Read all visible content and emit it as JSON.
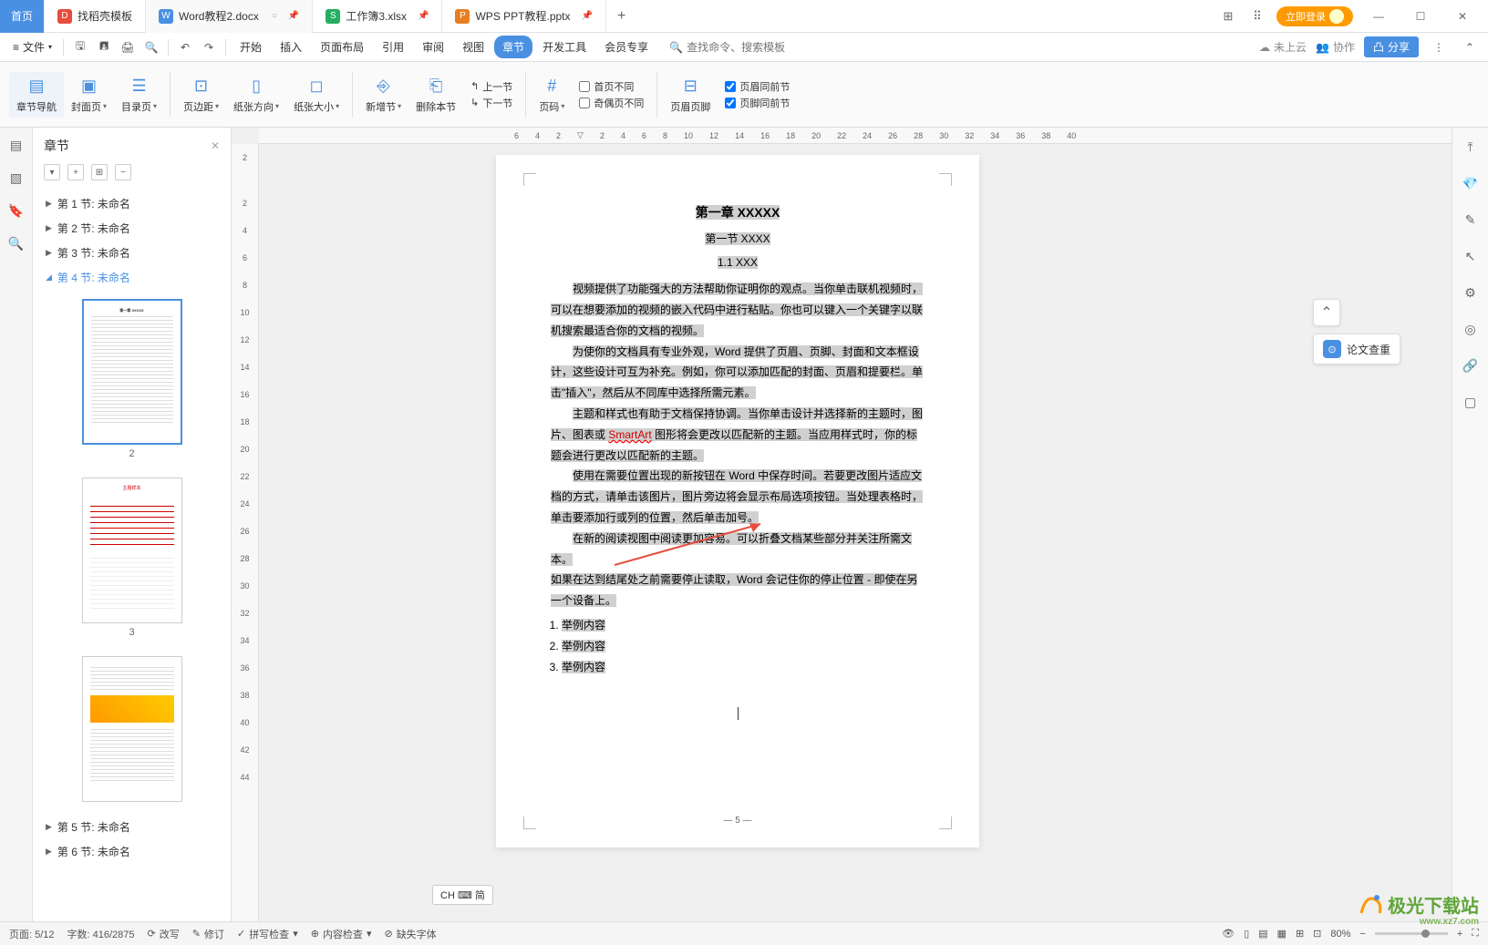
{
  "tabs": {
    "home": "首页",
    "t1": "找稻壳模板",
    "t2": "Word教程2.docx",
    "t3": "工作簿3.xlsx",
    "t4": "WPS PPT教程.pptx"
  },
  "titleRight": {
    "login": "立即登录"
  },
  "menu": {
    "file": "文件",
    "items": [
      "开始",
      "插入",
      "页面布局",
      "引用",
      "审阅",
      "视图",
      "章节",
      "开发工具",
      "会员专享"
    ],
    "searchPlaceholder": "查找命令、搜索模板",
    "cloud": "未上云",
    "coop": "协作",
    "share": "分享"
  },
  "ribbon": {
    "nav": "章节导航",
    "cover": "封面页",
    "toc": "目录页",
    "margin": "页边距",
    "orient": "纸张方向",
    "size": "纸张大小",
    "newSec": "新增节",
    "delSec": "删除本节",
    "prevSec": "上一节",
    "nextSec": "下一节",
    "pageNum": "页码",
    "firstDiff": "首页不同",
    "oddEven": "奇偶页不同",
    "headFoot": "页眉页脚",
    "headSame": "页眉同前节",
    "footSame": "页脚同前节"
  },
  "panel": {
    "title": "章节",
    "sections": [
      "第 1 节: 未命名",
      "第 2 节: 未命名",
      "第 3 节: 未命名",
      "第 4 节: 未命名",
      "第 5 节: 未命名",
      "第 6 节: 未命名"
    ],
    "thumbNums": [
      "2",
      "3"
    ]
  },
  "doc": {
    "h1": "第一章  XXXXX",
    "h2": "第一节  XXXX",
    "h3": "1.1 XXX",
    "p1a": "视频提供了功能强大的方法帮助你证明你的观点。当你单击联机视频时，",
    "p1b": "可以在想要添加的视频的嵌入代码中进行粘贴。你也可以键入一个关键字以联",
    "p1c": "机搜索最适合你的文档的视频。",
    "p2a": "为使你的文档具有专业外观，Word 提供了页眉、页脚、封面和文本框设",
    "p2b": "计，这些设计可互为补充。例如，你可以添加匹配的封面、页眉和提要栏。单",
    "p2c": "击\"插入\"，然后从不同库中选择所需元素。",
    "p3a": "主题和样式也有助于文档保持协调。当你单击设计并选择新的主题时，图",
    "p3b1": "片、图表或 ",
    "p3err": "SmartArt",
    "p3b2": " 图形将会更改以匹配新的主题。当应用样式时，你的标",
    "p3c": "题会进行更改以匹配新的主题。",
    "p4a": "使用在需要位置出现的新按钮在 Word 中保存时间。若要更改图片适应文",
    "p4b": "档的方式，请单击该图片，图片旁边将会显示布局选项按钮。当处理表格时，",
    "p4c": "单击要添加行或列的位置，然后单击加号。",
    "p5a": "在新的阅读视图中阅读更加容易。可以折叠文档某些部分并关注所需文本。",
    "p5b": "如果在达到结尾处之前需要停止读取，Word 会记住你的停止位置 - 即使在另",
    "p5c": "一个设备上。",
    "li": "举例内容",
    "pageNum": "— 5 —"
  },
  "ruler": {
    "h": [
      "6",
      "4",
      "2",
      "",
      "2",
      "4",
      "6",
      "8",
      "10",
      "12",
      "14",
      "16",
      "18",
      "20",
      "22",
      "24",
      "26",
      "28",
      "30",
      "32",
      "34",
      "36",
      "38",
      "40"
    ],
    "v": [
      "2",
      "",
      "2",
      "4",
      "6",
      "8",
      "10",
      "12",
      "14",
      "16",
      "18",
      "20",
      "22",
      "24",
      "26",
      "28",
      "30",
      "32",
      "34",
      "36",
      "38",
      "40",
      "42",
      "44"
    ]
  },
  "floatPanel": {
    "check": "论文查重"
  },
  "ime": "CH ⌨ 简",
  "status": {
    "page": "页面: 5/12",
    "words": "字数: 416/2875",
    "rewrite": "改写",
    "revise": "修订",
    "spell": "拼写检查",
    "content": "内容检查",
    "font": "缺失字体",
    "zoom": "80%"
  },
  "watermark": {
    "name": "极光下载站",
    "url": "www.xz7.com"
  }
}
